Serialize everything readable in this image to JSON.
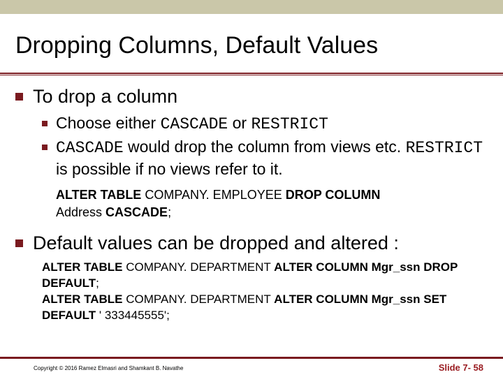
{
  "title": "Dropping Columns, Default Values",
  "bullets": {
    "b1": "To drop a column",
    "b1a_pre": "Choose either ",
    "b1a_code1": "CASCADE",
    "b1a_mid": " or ",
    "b1a_code2": "RESTRICT",
    "b1b_code1": "CASCADE",
    "b1b_mid1": "  would drop the column from views etc. ",
    "b1b_code2": "RESTRICT",
    "b1b_mid2": "  is possible if no views refer to it.",
    "sql1_l1a": "ALTER TABLE",
    "sql1_l1b": " COMPANY. EMPLOYEE ",
    "sql1_l1c": "DROP COLUMN",
    "sql1_l2a": "Address ",
    "sql1_l2b": "CASCADE",
    "sql1_l2c": ";",
    "b2": "Default values can be dropped and altered :",
    "sql2_l1a": "ALTER TABLE",
    "sql2_l1b": " COMPANY. DEPARTMENT ",
    "sql2_l1c": "ALTER COLUMN Mgr_ssn DROP DEFAULT",
    "sql2_l1d": ";",
    "sql2_l2a": "ALTER TABLE",
    "sql2_l2b": " COMPANY. DEPARTMENT ",
    "sql2_l2c": "ALTER COLUMN Mgr_ssn SET DEFAULT",
    "sql2_l2d": " ' 333445555';"
  },
  "footer": {
    "copyright": "Copyright © 2016 Ramez Elmasri and Shamkant B. Navathe",
    "slidenum": "Slide 7- 58"
  }
}
